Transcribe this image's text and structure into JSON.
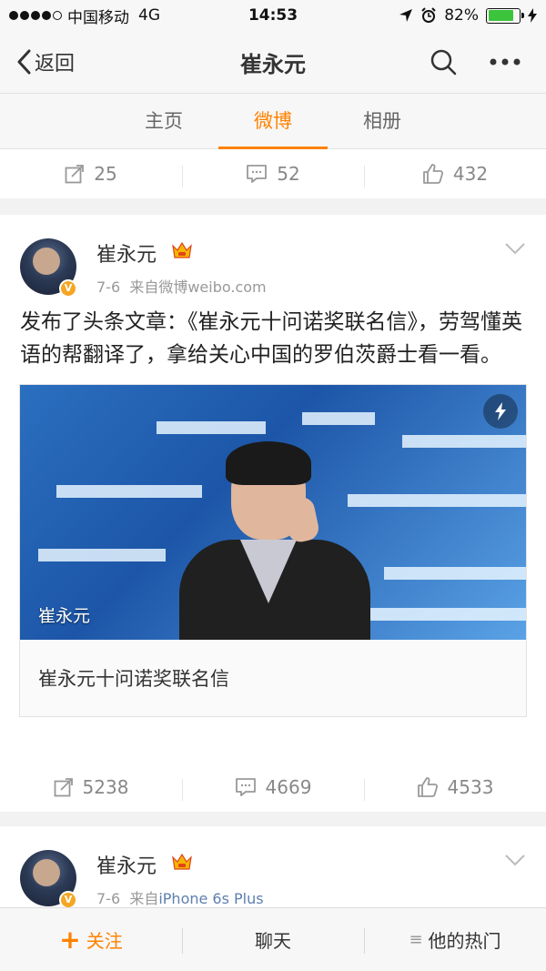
{
  "status_bar": {
    "carrier": "中国移动",
    "network": "4G",
    "time": "14:53",
    "battery": "82%",
    "battery_level": 0.82
  },
  "nav": {
    "back_label": "返回",
    "title": "崔永元"
  },
  "tabs": [
    {
      "label": "主页",
      "active": false
    },
    {
      "label": "微博",
      "active": true
    },
    {
      "label": "相册",
      "active": false
    }
  ],
  "top_actions": {
    "repost_count": "25",
    "comment_count": "52",
    "like_count": "432"
  },
  "post1": {
    "user_name": "崔永元",
    "date": "7-6",
    "source_prefix": "来自微博",
    "source": "weibo.com",
    "text": "发布了头条文章：《崔永元十问诺奖联名信》，劳驾懂英语的帮翻译了，拿给关心中国的罗伯茨爵士看一看。",
    "image_caption": "崔永元",
    "article_title": "崔永元十问诺奖联名信",
    "repost_count": "5238",
    "comment_count": "4669",
    "like_count": "4533"
  },
  "post2": {
    "user_name": "崔永元",
    "date": "7-6",
    "source_prefix": "来自",
    "source": "iPhone 6s Plus"
  },
  "bottom_bar": {
    "follow_label": "关注",
    "chat_label": "聊天",
    "hot_label": "他的热门"
  },
  "colors": {
    "accent": "#ff8200",
    "link": "#5d7fb0"
  }
}
